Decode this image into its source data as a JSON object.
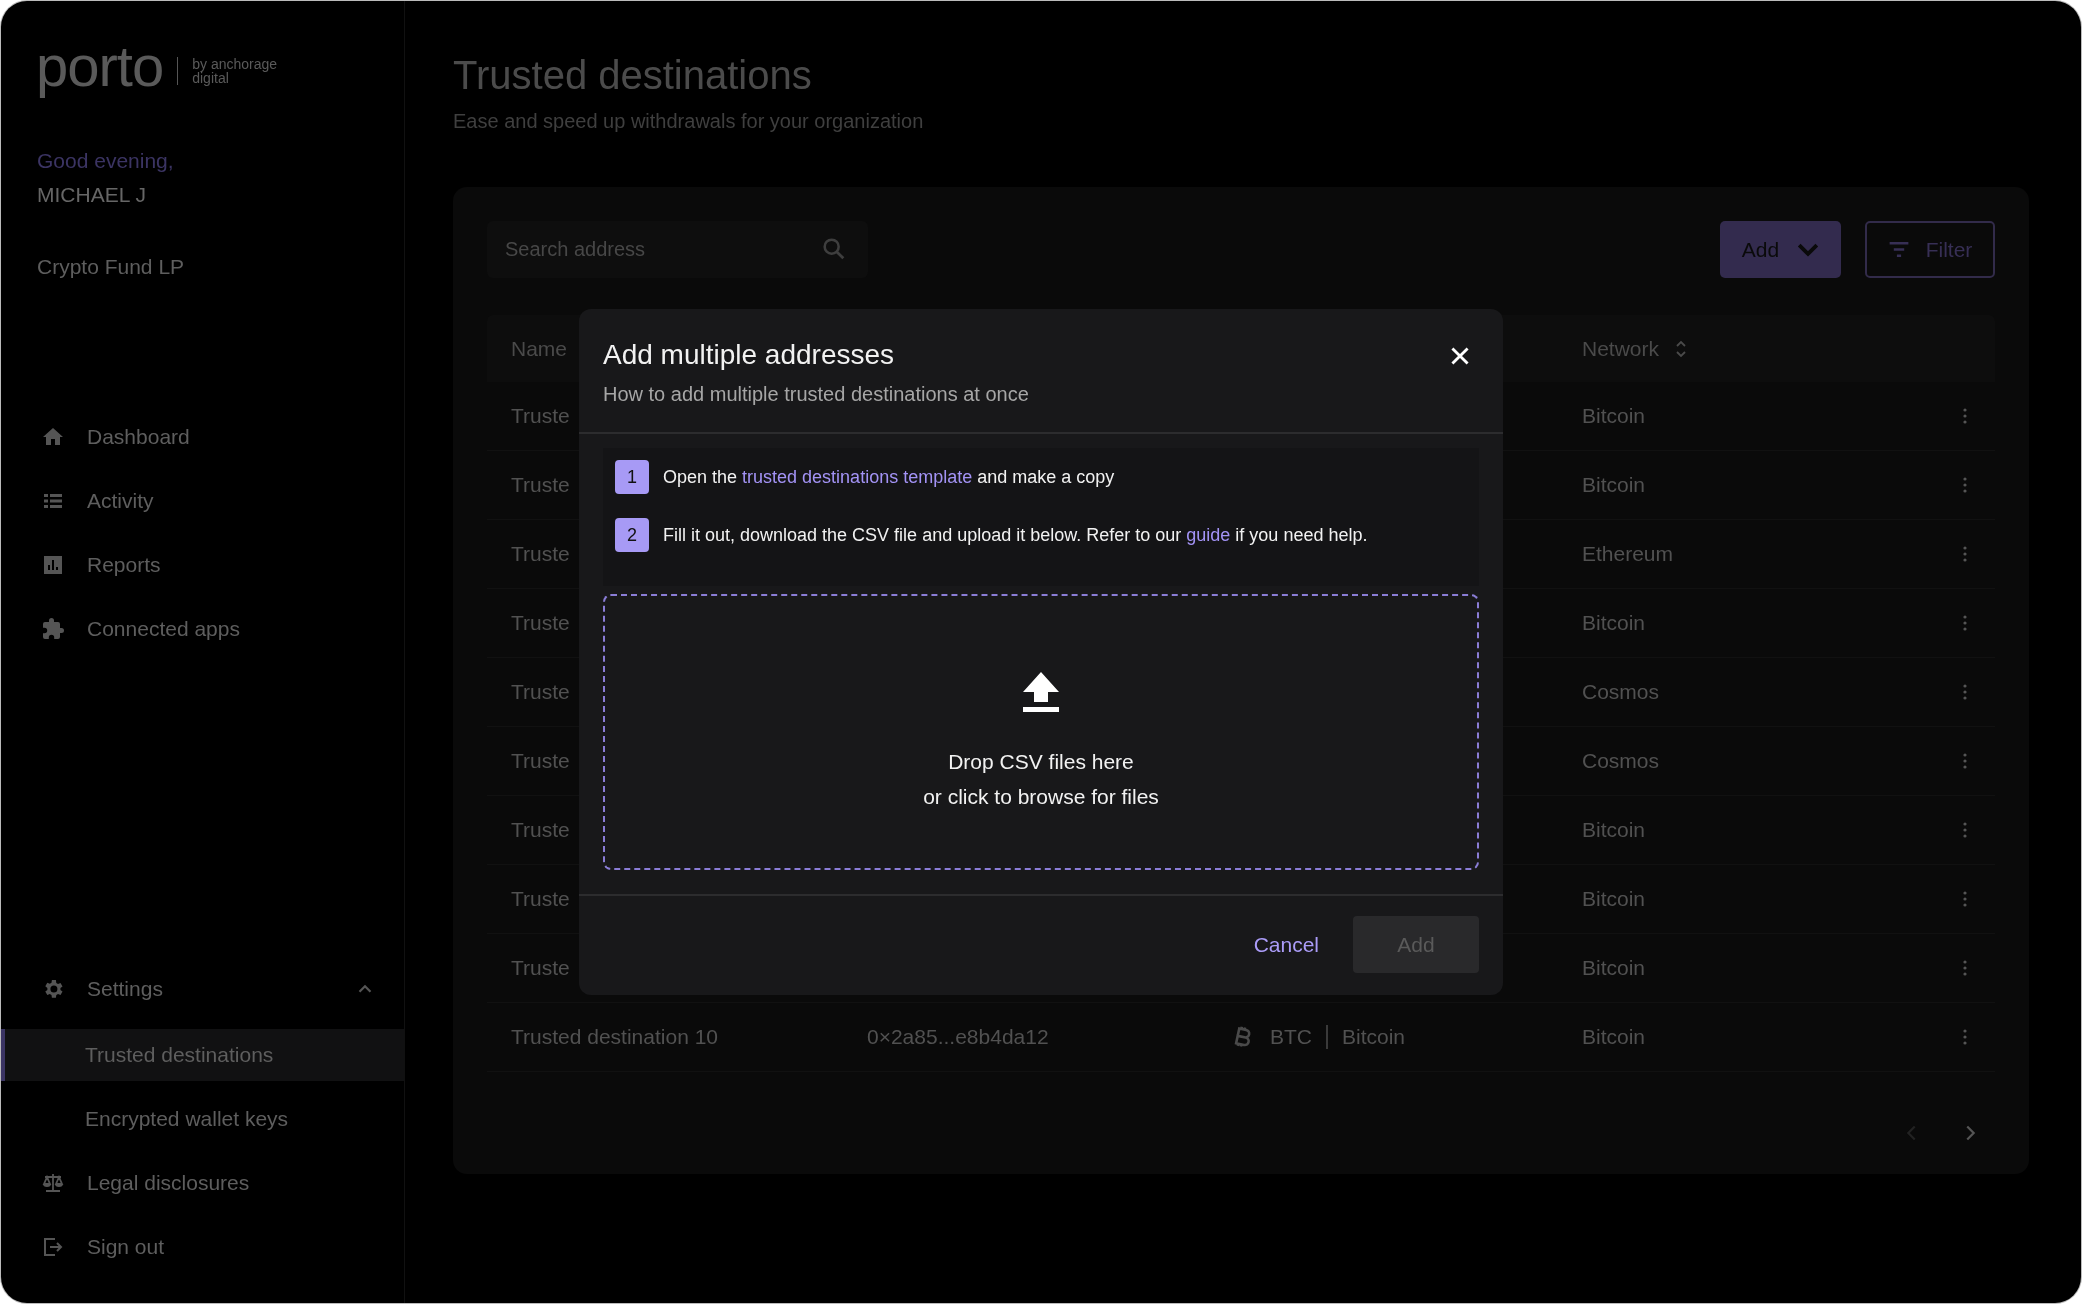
{
  "sidebar": {
    "logo": {
      "word": "porto",
      "tagline_1": "by anchorage",
      "tagline_2": "digital"
    },
    "greeting": "Good evening,",
    "user": "MICHAEL J",
    "organization": "Crypto Fund LP",
    "nav": [
      {
        "label": "Dashboard",
        "selected": false
      },
      {
        "label": "Activity",
        "selected": false
      },
      {
        "label": "Reports",
        "selected": false
      },
      {
        "label": "Connected apps",
        "selected": false
      }
    ],
    "settings": {
      "label": "Settings",
      "expanded": true,
      "children": [
        {
          "label": "Trusted destinations",
          "selected": true
        },
        {
          "label": "Encrypted wallet keys",
          "selected": false
        }
      ]
    },
    "footer": [
      {
        "label": "Legal disclosures",
        "selected": false
      },
      {
        "label": "Sign out",
        "selected": false
      }
    ]
  },
  "page": {
    "title": "Trusted destinations",
    "subtitle": "Ease and speed up withdrawals for your organization"
  },
  "toolbar": {
    "search": {
      "placeholder": "Search address"
    },
    "add_button": "Add",
    "filter_button": "Filter"
  },
  "table": {
    "columns": [
      {
        "label": "Name"
      },
      {
        "label": "Network",
        "sortable": true
      }
    ],
    "rows": [
      {
        "name": "Truste",
        "network": "Bitcoin"
      },
      {
        "name": "Truste",
        "network": "Bitcoin"
      },
      {
        "name": "Truste",
        "network": "Ethereum"
      },
      {
        "name": "Truste",
        "network": "Bitcoin"
      },
      {
        "name": "Truste",
        "network": "Cosmos"
      },
      {
        "name": "Truste",
        "network": "Cosmos"
      },
      {
        "name": "Truste",
        "network": "Bitcoin"
      },
      {
        "name": "Truste",
        "network": "Bitcoin"
      },
      {
        "name": "Truste",
        "network": "Bitcoin"
      },
      {
        "name": "Trusted destination 10",
        "address": "0×2a85...e8b4da12",
        "asset_code": "BTC",
        "asset_name": "Bitcoin",
        "network": "Bitcoin"
      }
    ]
  },
  "pagination": {
    "previous_disabled": true,
    "next_disabled": false
  },
  "modal": {
    "title": "Add multiple addresses",
    "subtitle": "How to add multiple trusted destinations at once",
    "steps": [
      {
        "number": "1",
        "before": "Open the ",
        "link": "trusted destinations template",
        "after": " and make a copy"
      },
      {
        "number": "2",
        "before": "Fill it out, download the CSV file and upload it below. Refer to our ",
        "link": "guide",
        "after": " if you need help."
      }
    ],
    "dropzone": {
      "line_1": "Drop CSV files here",
      "line_2": "or click to browse for files"
    },
    "cancel_button": "Cancel",
    "add_button": {
      "label": "Add",
      "disabled": true
    }
  }
}
